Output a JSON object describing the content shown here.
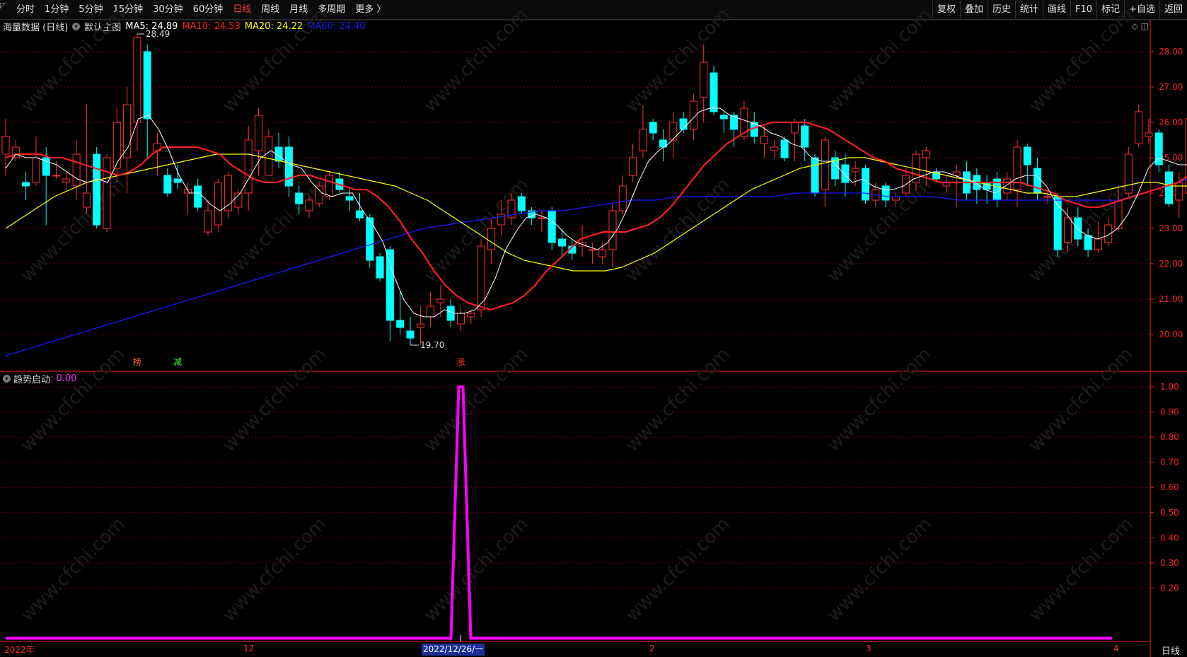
{
  "toolbar": {
    "tabs": [
      "分时",
      "1分钟",
      "5分钟",
      "15分钟",
      "30分钟",
      "60分钟",
      "日线",
      "周线",
      "月线",
      "多周期",
      "更多 〉"
    ],
    "active_tab": "日线",
    "tools": [
      "复权",
      "叠加",
      "历史",
      "统计",
      "画线",
      "F10",
      "标记",
      "+自选",
      "返回"
    ]
  },
  "main_chart": {
    "name": "海量数据 (日线)",
    "template": "默认主图",
    "ma": [
      {
        "label": "MA5: 24.89",
        "color": "#ffffff"
      },
      {
        "label": "MA10: 24.53",
        "color": "#ff2020"
      },
      {
        "label": "MA20: 24.22",
        "color": "#ffff00"
      },
      {
        "label": "MA60: 24.40",
        "color": "#1a1aff"
      }
    ],
    "high_label": "28.49",
    "low_label": "19.70",
    "y_ticks": [
      "28.00",
      "27.00",
      "26.00",
      "25.00",
      "24.00",
      "23.00",
      "22.00",
      "21.00",
      "20.00"
    ],
    "markers": [
      {
        "text": "榜",
        "color": "#ff6633"
      },
      {
        "text": "减",
        "color": "#33ff33"
      },
      {
        "text": "涨",
        "color": "#ff3333"
      }
    ]
  },
  "sub_chart": {
    "name": "趋势启动",
    "value": ": 0.00",
    "y_ticks": [
      "1.00",
      "0.90",
      "0.80",
      "0.70",
      "0.60",
      "0.50",
      "0.40",
      "0.30",
      "0.20"
    ]
  },
  "x_axis": {
    "labels": [
      "2022年",
      "12",
      "2",
      "3",
      "4"
    ],
    "cursor_date": "2022/12/26/一",
    "period": "日线"
  },
  "watermark": "www.cfchi.com",
  "colors": {
    "up": "#ff3030",
    "down": "#00ffff",
    "signal": "#ff00ff",
    "grid": "#6a0000",
    "axis": "#ff2020"
  },
  "chart_data": {
    "type": "candlestick",
    "ylim": [
      19.5,
      28.6
    ],
    "candles": [
      [
        25.1,
        25.6,
        24.5,
        26.1
      ],
      [
        25.0,
        25.3,
        24.9,
        25.5
      ],
      [
        24.3,
        24.2,
        23.8,
        24.6
      ],
      [
        24.3,
        25.0,
        24.2,
        25.6
      ],
      [
        25.0,
        24.5,
        23.1,
        25.3
      ],
      [
        24.5,
        24.5,
        24.4,
        24.9
      ],
      [
        24.3,
        24.4,
        24.1,
        24.6
      ],
      [
        24.2,
        25.1,
        23.8,
        25.5
      ],
      [
        23.6,
        24.0,
        23.4,
        26.5
      ],
      [
        25.1,
        23.1,
        23.0,
        25.3
      ],
      [
        23.0,
        25.0,
        22.9,
        25.1
      ],
      [
        24.7,
        26.0,
        24.3,
        26.4
      ],
      [
        25.0,
        26.5,
        24.0,
        27.0
      ],
      [
        26.0,
        28.4,
        25.2,
        28.5
      ],
      [
        28.0,
        26.1,
        25.0,
        28.2
      ],
      [
        25.2,
        25.4,
        24.5,
        25.7
      ],
      [
        24.5,
        24.0,
        23.9,
        24.7
      ],
      [
        24.4,
        24.3,
        24.1,
        24.8
      ],
      [
        24.0,
        24.1,
        23.4,
        24.3
      ],
      [
        24.2,
        23.6,
        23.5,
        24.4
      ],
      [
        22.9,
        23.5,
        22.8,
        23.8
      ],
      [
        23.1,
        24.3,
        22.9,
        24.4
      ],
      [
        23.5,
        24.5,
        23.3,
        24.6
      ],
      [
        23.6,
        24.0,
        23.4,
        24.1
      ],
      [
        24.0,
        25.5,
        23.5,
        25.9
      ],
      [
        25.2,
        26.2,
        24.5,
        26.4
      ],
      [
        24.5,
        25.6,
        24.6,
        25.8
      ],
      [
        25.3,
        24.9,
        24.7,
        25.7
      ],
      [
        25.3,
        24.2,
        23.9,
        25.6
      ],
      [
        24.0,
        23.7,
        23.4,
        24.2
      ],
      [
        23.5,
        23.8,
        23.3,
        23.9
      ],
      [
        23.7,
        24.2,
        23.6,
        24.3
      ],
      [
        23.9,
        24.5,
        23.8,
        24.6
      ],
      [
        24.4,
        24.1,
        24.0,
        24.6
      ],
      [
        23.9,
        23.8,
        23.5,
        24.1
      ],
      [
        23.5,
        23.3,
        23.2,
        24.0
      ],
      [
        23.3,
        22.1,
        21.9,
        23.4
      ],
      [
        22.2,
        21.6,
        21.5,
        22.3
      ],
      [
        22.4,
        20.4,
        19.8,
        22.5
      ],
      [
        20.4,
        20.2,
        20.0,
        21.2
      ],
      [
        20.1,
        19.9,
        19.7,
        20.5
      ],
      [
        20.2,
        20.3,
        19.7,
        20.8
      ],
      [
        20.5,
        20.8,
        20.2,
        21.2
      ],
      [
        20.9,
        21.0,
        20.5,
        21.4
      ],
      [
        20.8,
        20.4,
        20.2,
        21.0
      ],
      [
        20.3,
        20.6,
        20.1,
        20.8
      ],
      [
        20.5,
        20.6,
        20.3,
        20.7
      ],
      [
        20.7,
        22.5,
        20.5,
        22.7
      ],
      [
        22.4,
        23.0,
        22.0,
        23.3
      ],
      [
        23.1,
        23.4,
        22.8,
        23.8
      ],
      [
        23.3,
        23.8,
        23.1,
        24.0
      ],
      [
        23.9,
        23.5,
        23.4,
        24.0
      ],
      [
        23.5,
        23.3,
        23.1,
        23.6
      ],
      [
        23.3,
        23.3,
        22.9,
        23.5
      ],
      [
        23.5,
        22.6,
        22.4,
        23.6
      ],
      [
        22.7,
        22.5,
        22.2,
        23.0
      ],
      [
        22.5,
        22.3,
        22.1,
        22.7
      ],
      [
        22.5,
        22.6,
        22.2,
        23.1
      ],
      [
        22.4,
        22.4,
        22.0,
        22.6
      ],
      [
        22.2,
        22.4,
        22.0,
        22.6
      ],
      [
        22.4,
        23.5,
        21.9,
        23.7
      ],
      [
        23.5,
        24.2,
        23.4,
        24.5
      ],
      [
        24.5,
        25.0,
        24.3,
        25.4
      ],
      [
        25.2,
        25.8,
        25.0,
        26.5
      ],
      [
        26.0,
        25.7,
        25.5,
        26.1
      ],
      [
        25.5,
        25.3,
        24.9,
        25.8
      ],
      [
        25.5,
        26.0,
        25.0,
        26.3
      ],
      [
        26.1,
        25.8,
        25.7,
        26.3
      ],
      [
        25.8,
        26.6,
        25.5,
        26.8
      ],
      [
        26.7,
        27.7,
        26.0,
        28.2
      ],
      [
        27.4,
        26.3,
        26.2,
        27.6
      ],
      [
        26.2,
        26.1,
        25.7,
        26.3
      ],
      [
        26.2,
        25.8,
        25.3,
        26.3
      ],
      [
        25.6,
        26.4,
        25.5,
        26.6
      ],
      [
        26.0,
        25.6,
        25.4,
        26.3
      ],
      [
        25.4,
        25.6,
        25.0,
        25.9
      ],
      [
        25.2,
        25.3,
        25.0,
        25.5
      ],
      [
        25.5,
        25.0,
        24.9,
        25.6
      ],
      [
        25.7,
        26.0,
        24.9,
        26.1
      ],
      [
        25.9,
        25.3,
        24.9,
        26.1
      ],
      [
        25.0,
        24.0,
        23.9,
        25.1
      ],
      [
        24.1,
        25.5,
        23.6,
        25.6
      ],
      [
        25.0,
        24.4,
        24.2,
        25.2
      ],
      [
        24.8,
        24.3,
        23.9,
        25.1
      ],
      [
        24.6,
        24.7,
        24.2,
        24.9
      ],
      [
        24.7,
        23.8,
        23.7,
        24.8
      ],
      [
        23.8,
        24.1,
        23.6,
        24.3
      ],
      [
        24.2,
        23.8,
        23.6,
        24.3
      ],
      [
        23.8,
        23.9,
        23.6,
        24.0
      ],
      [
        24.0,
        24.5,
        23.9,
        24.7
      ],
      [
        24.3,
        25.1,
        24.1,
        25.2
      ],
      [
        25.0,
        25.2,
        24.2,
        25.3
      ],
      [
        24.6,
        24.4,
        24.3,
        24.7
      ],
      [
        24.2,
        24.3,
        24.0,
        24.5
      ],
      [
        24.5,
        24.6,
        23.6,
        24.8
      ],
      [
        24.6,
        24.0,
        23.8,
        24.9
      ],
      [
        24.5,
        24.1,
        23.7,
        24.7
      ],
      [
        24.3,
        24.1,
        23.7,
        24.5
      ],
      [
        24.4,
        23.8,
        23.6,
        24.6
      ],
      [
        24.0,
        24.4,
        23.8,
        24.6
      ],
      [
        24.1,
        25.3,
        23.6,
        25.5
      ],
      [
        25.3,
        24.8,
        24.2,
        25.4
      ],
      [
        24.7,
        24.0,
        23.8,
        25.0
      ],
      [
        23.9,
        23.9,
        23.7,
        24.1
      ],
      [
        23.9,
        22.4,
        22.2,
        24.0
      ],
      [
        22.6,
        23.3,
        22.3,
        23.6
      ],
      [
        23.3,
        22.7,
        22.5,
        23.6
      ],
      [
        22.8,
        22.4,
        22.2,
        23.0
      ],
      [
        22.4,
        22.7,
        22.3,
        23.2
      ],
      [
        22.6,
        23.1,
        22.5,
        23.3
      ],
      [
        23.0,
        23.8,
        22.9,
        24.2
      ],
      [
        24.0,
        25.1,
        23.9,
        25.3
      ],
      [
        25.4,
        26.3,
        25.3,
        26.5
      ],
      [
        25.6,
        25.7,
        25.4,
        26.1
      ],
      [
        25.7,
        24.8,
        24.6,
        25.8
      ],
      [
        24.6,
        23.7,
        23.6,
        24.8
      ],
      [
        23.8,
        24.3,
        23.3,
        24.6
      ],
      [
        24.0,
        26.1,
        23.9,
        26.3
      ]
    ],
    "ma5": [
      24.7,
      25.1,
      25.0,
      25.0,
      24.9,
      24.8,
      24.6,
      24.4,
      24.3,
      24.4,
      24.3,
      24.9,
      25.3,
      26.1,
      26.2,
      25.8,
      25.2,
      24.5,
      24.0,
      24.0,
      23.7,
      23.5,
      23.7,
      24.0,
      24.5,
      25.0,
      25.2,
      25.0,
      24.8,
      24.7,
      24.3,
      24.0,
      23.9,
      24.0,
      24.0,
      23.5,
      23.1,
      22.6,
      21.7,
      21.0,
      20.6,
      20.5,
      20.5,
      20.7,
      20.6,
      20.6,
      20.7,
      21.0,
      21.6,
      22.4,
      22.9,
      23.3,
      23.4,
      23.3,
      23.1,
      22.8,
      22.6,
      22.5,
      22.4,
      22.6,
      23.0,
      23.6,
      24.3,
      24.9,
      25.2,
      25.4,
      25.7,
      26.0,
      26.3,
      26.4,
      26.4,
      26.2,
      26.1,
      26.0,
      25.9,
      25.7,
      25.6,
      25.4,
      25.3,
      25.0,
      24.9,
      24.9,
      24.6,
      24.3,
      24.4,
      24.2,
      24.1,
      24.1,
      24.2,
      24.4,
      24.5,
      24.6,
      24.6,
      24.5,
      24.4,
      24.3,
      24.1,
      24.0,
      24.2,
      24.4,
      24.5,
      24.5,
      24.2,
      23.7,
      23.4,
      23.0,
      22.8,
      22.7,
      22.8,
      23.0,
      23.4,
      24.0,
      24.7,
      25.0,
      24.9,
      24.8,
      24.8
    ],
    "ma10": [
      25.0,
      25.1,
      25.1,
      25.1,
      25.0,
      25.0,
      24.9,
      24.8,
      24.7,
      24.6,
      24.5,
      24.6,
      24.8,
      25.1,
      25.3,
      25.3,
      25.3,
      25.3,
      25.2,
      25.1,
      24.8,
      24.6,
      24.4,
      24.3,
      24.3,
      24.4,
      24.5,
      24.5,
      24.4,
      24.3,
      24.2,
      24.1,
      24.1,
      23.9,
      23.6,
      23.2,
      22.7,
      22.3,
      21.8,
      21.4,
      21.1,
      20.9,
      20.8,
      20.7,
      20.8,
      20.9,
      21.1,
      21.4,
      21.8,
      22.1,
      22.4,
      22.7,
      22.8,
      22.9,
      22.9,
      22.9,
      23.0,
      23.1,
      23.3,
      23.6,
      24.0,
      24.4,
      24.8,
      25.1,
      25.4,
      25.6,
      25.8,
      25.9,
      26.0,
      26.0,
      26.0,
      26.0,
      25.9,
      25.8,
      25.6,
      25.4,
      25.2,
      25.0,
      24.9,
      24.7,
      24.6,
      24.5,
      24.4,
      24.3,
      24.3,
      24.3,
      24.3,
      24.3,
      24.3,
      24.3,
      24.3,
      24.2,
      24.1,
      24.0,
      23.8,
      23.7,
      23.6,
      23.6,
      23.7,
      23.8,
      23.9,
      24.0,
      24.1,
      24.2,
      24.3,
      24.5
    ],
    "ma20": [
      23.0,
      23.3,
      23.6,
      23.9,
      24.1,
      24.3,
      24.4,
      24.5,
      24.6,
      24.7,
      24.8,
      24.9,
      25.0,
      25.1,
      25.1,
      25.1,
      25.0,
      24.9,
      24.8,
      24.7,
      24.6,
      24.5,
      24.4,
      24.3,
      24.2,
      24.0,
      23.8,
      23.5,
      23.2,
      22.9,
      22.6,
      22.3,
      22.1,
      22.0,
      21.9,
      21.8,
      21.8,
      21.8,
      21.9,
      22.1,
      22.3,
      22.6,
      22.9,
      23.2,
      23.5,
      23.8,
      24.1,
      24.3,
      24.5,
      24.7,
      24.8,
      24.9,
      25.0,
      25.0,
      24.9,
      24.8,
      24.7,
      24.6,
      24.5,
      24.4,
      24.3,
      24.2,
      24.1,
      24.0,
      24.0,
      23.9,
      23.9,
      24.0,
      24.1,
      24.2,
      24.3,
      24.3,
      24.2,
      24.2
    ],
    "ma60": [
      19.4,
      19.6,
      19.8,
      20.0,
      20.2,
      20.4,
      20.6,
      20.8,
      21.0,
      21.2,
      21.4,
      21.6,
      21.8,
      22.0,
      22.2,
      22.4,
      22.6,
      22.8,
      23.0,
      23.1,
      23.2,
      23.3,
      23.4,
      23.5,
      23.5,
      23.6,
      23.7,
      23.8,
      23.8,
      23.9,
      23.9,
      23.9,
      23.9,
      23.9,
      24.0,
      24.0,
      24.0,
      24.0,
      23.9,
      23.9,
      23.9,
      23.8,
      23.8,
      23.8,
      23.8,
      23.8,
      23.8,
      23.8,
      23.8,
      24.0,
      24.2,
      24.4
    ],
    "signal": {
      "baseline": 0.0,
      "peak": 1.0,
      "peak_date": "2022/12/26"
    }
  }
}
